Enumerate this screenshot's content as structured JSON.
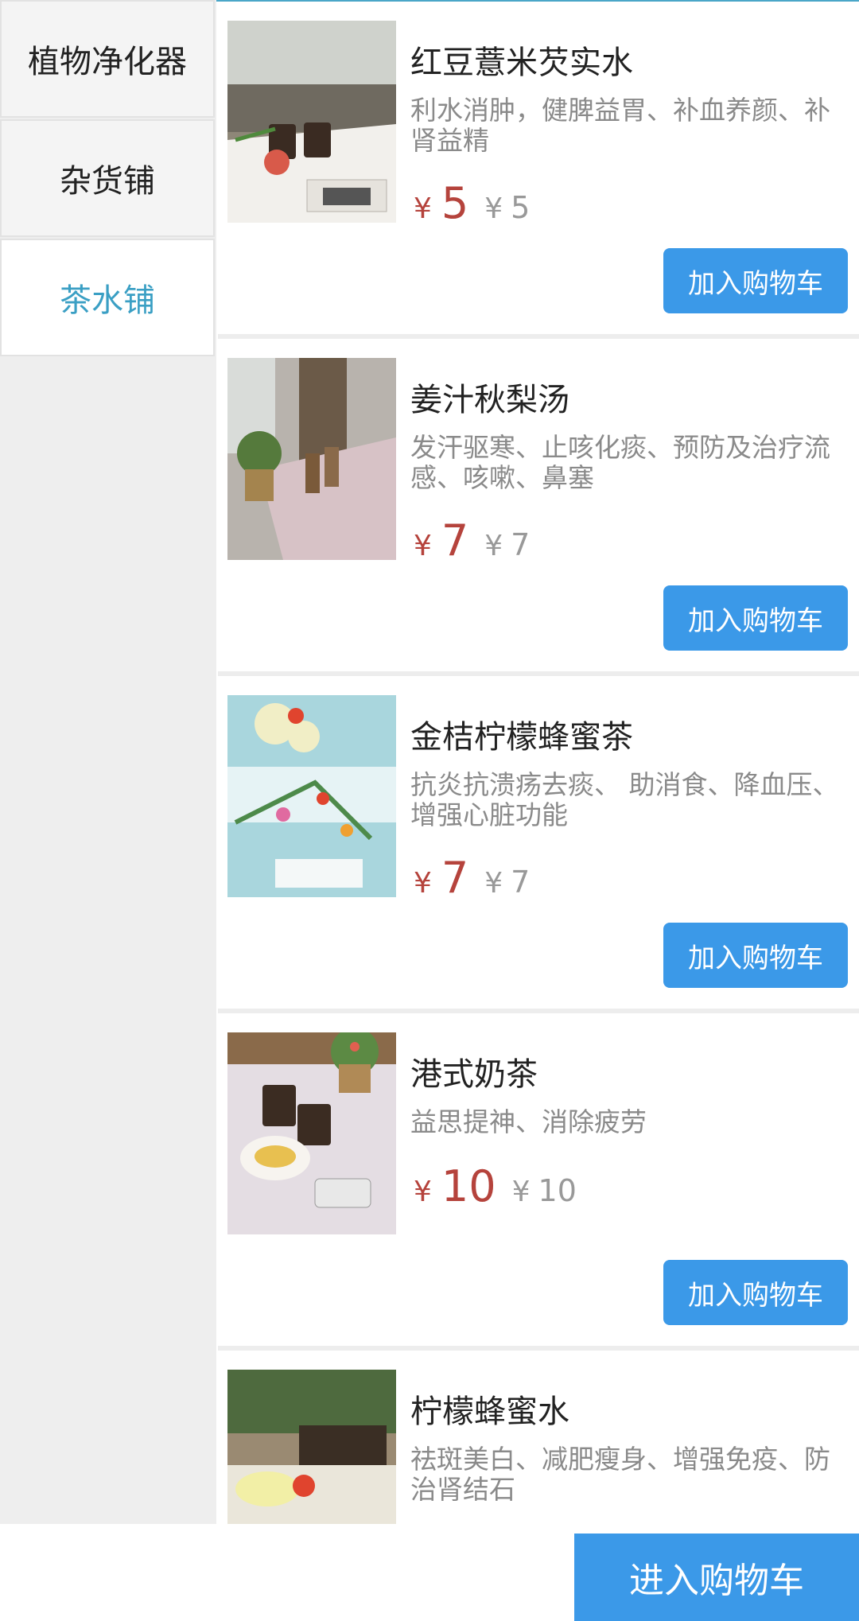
{
  "sidebar": {
    "categories": [
      {
        "label": "植物净化器"
      },
      {
        "label": "杂货铺"
      },
      {
        "label": "茶水铺"
      }
    ]
  },
  "products": [
    {
      "name": "红豆薏米芡实水",
      "desc": "利水消肿，健脾益胃、补血养颜、补肾益精",
      "currency": "¥",
      "price": "5",
      "original_price": "5",
      "add_label": "加入购物车"
    },
    {
      "name": "姜汁秋梨汤",
      "desc": "发汗驱寒、止咳化痰、预防及治疗流感、咳嗽、鼻塞",
      "currency": "¥",
      "price": "7",
      "original_price": "7",
      "add_label": "加入购物车"
    },
    {
      "name": "金桔柠檬蜂蜜茶",
      "desc": "抗炎抗溃疡去痰、 助消食、降血压、增强心脏功能",
      "currency": "¥",
      "price": "7",
      "original_price": "7",
      "add_label": "加入购物车"
    },
    {
      "name": "港式奶茶",
      "desc": "益思提神、消除疲劳",
      "currency": "¥",
      "price": "10",
      "original_price": "10",
      "add_label": "加入购物车"
    },
    {
      "name": "柠檬蜂蜜水",
      "desc": "祛斑美白、减肥瘦身、增强免疫、防治肾结石"
    }
  ],
  "footer": {
    "checkout_label": "进入购物车"
  },
  "colors": {
    "accent": "#3b99e8",
    "active_category": "#3a9fc4",
    "price": "#b5433c"
  }
}
